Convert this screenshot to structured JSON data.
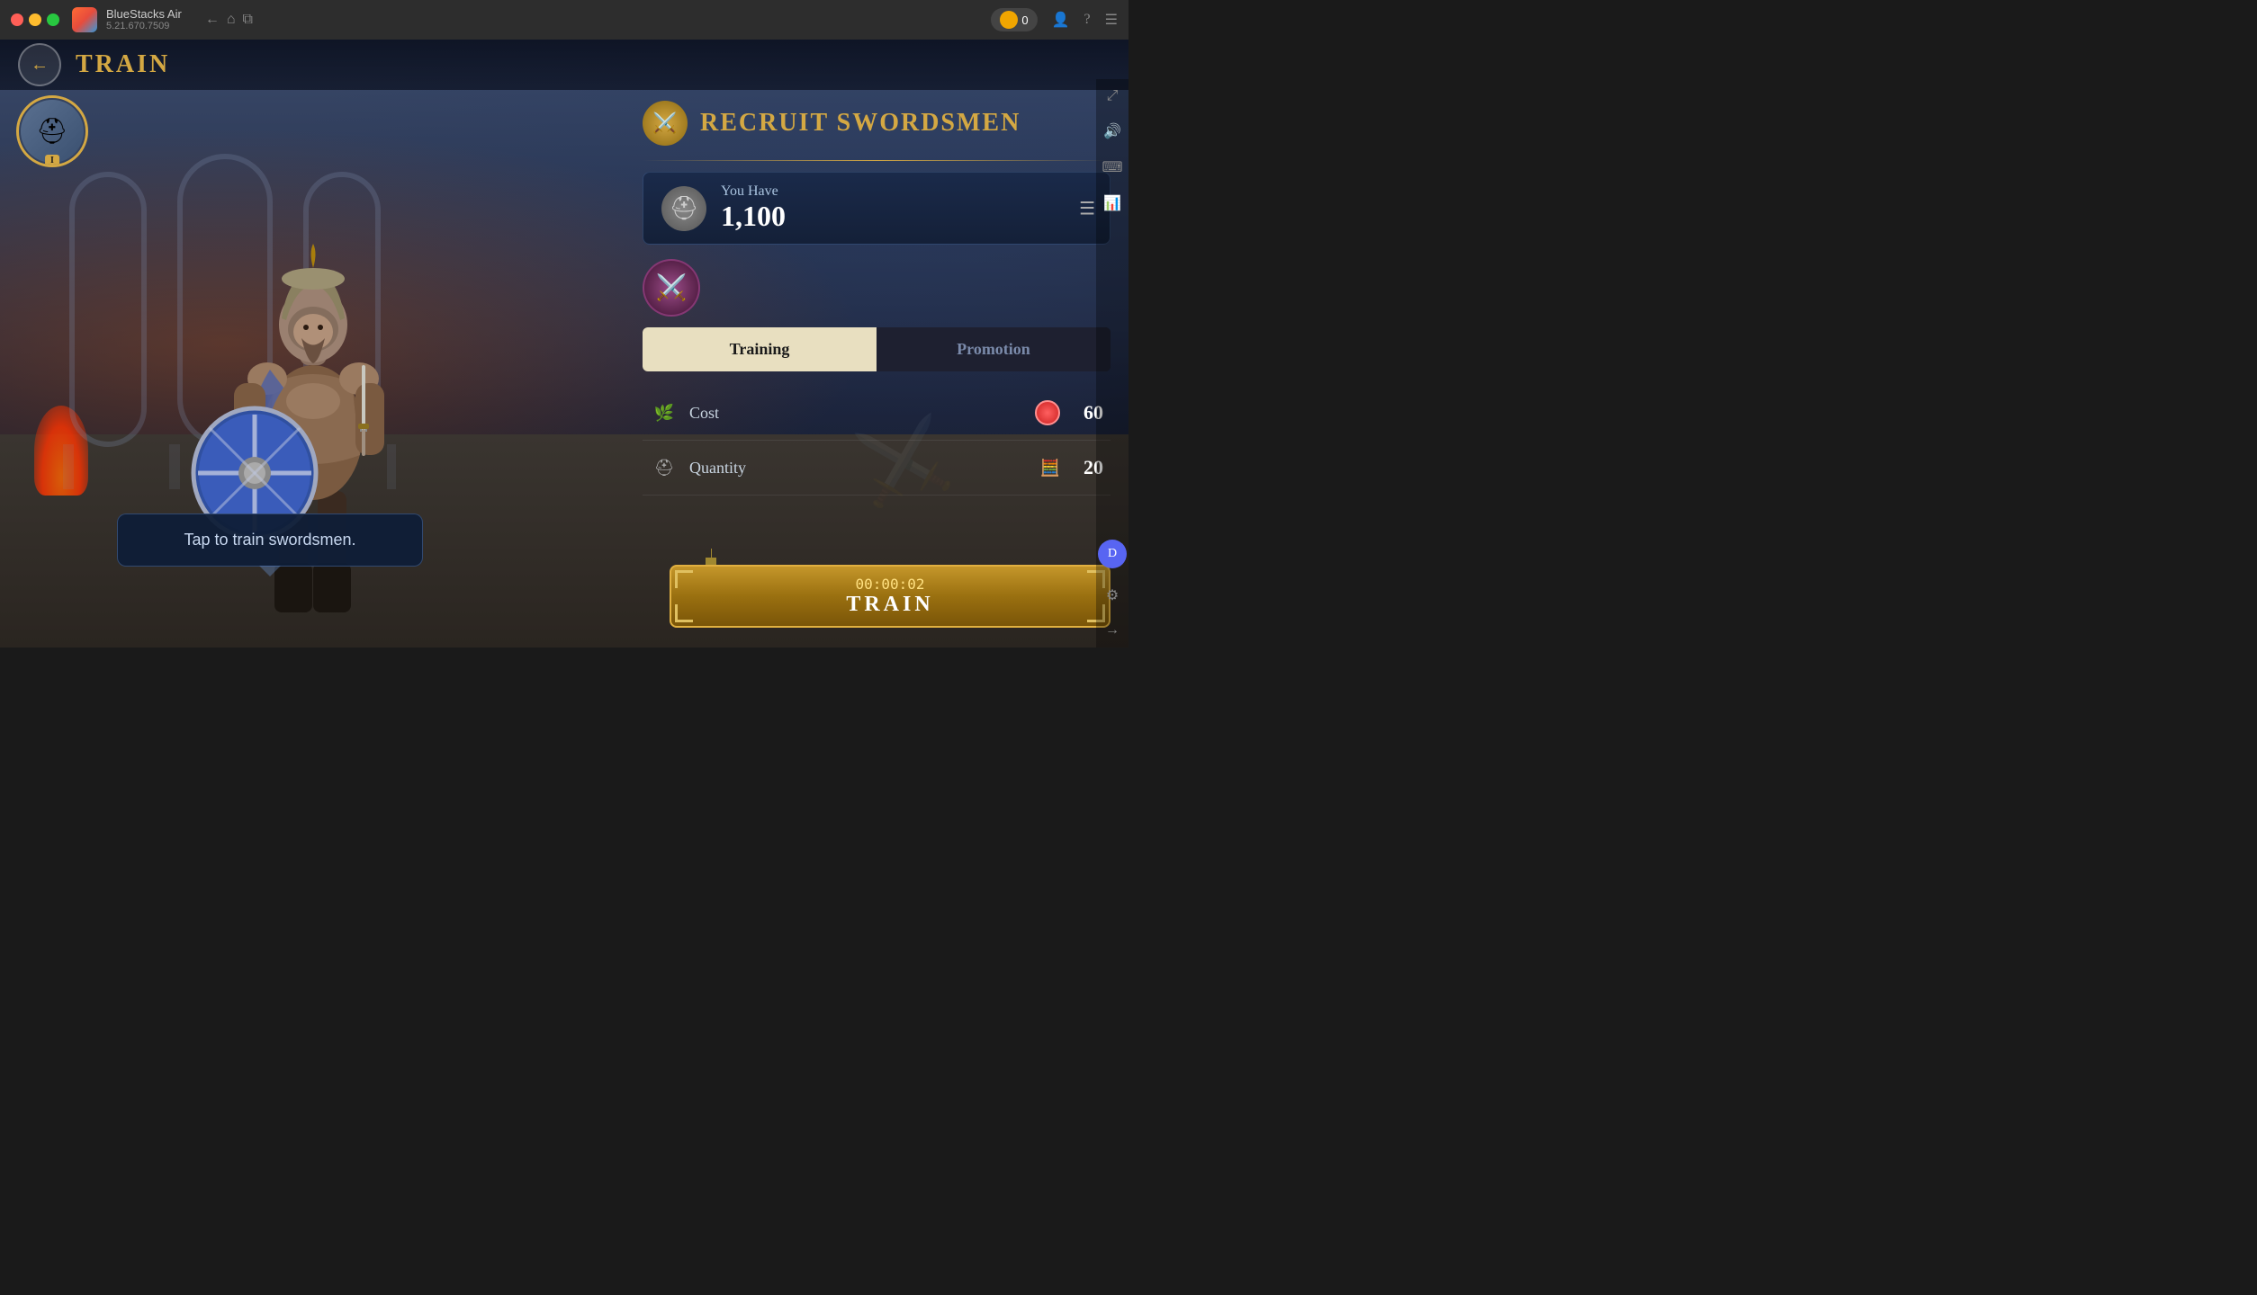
{
  "app": {
    "name": "BlueStacks Air",
    "version": "5.21.670.7509",
    "coin_count": "0"
  },
  "nav": {
    "back_label": "‹",
    "home_label": "⌂",
    "window_label": "⧉"
  },
  "game": {
    "header_title": "TRAIN",
    "recruit_title": "RECRUIT SWORDSMEN",
    "you_have_label": "You Have",
    "you_have_count": "1,100",
    "tabs": [
      {
        "id": "training",
        "label": "Training",
        "active": true
      },
      {
        "id": "promotion",
        "label": "Promotion",
        "active": false
      }
    ],
    "stats": [
      {
        "id": "cost",
        "icon": "🍃",
        "label": "Cost",
        "value": "60",
        "value_type": "gem"
      },
      {
        "id": "quantity",
        "icon": "⛑",
        "label": "Quantity",
        "value": "20",
        "value_type": "calc"
      }
    ],
    "tooltip": "Tap to train swordsmen.",
    "train_timer": "00:00:02",
    "train_button_label": "TRAIN"
  }
}
